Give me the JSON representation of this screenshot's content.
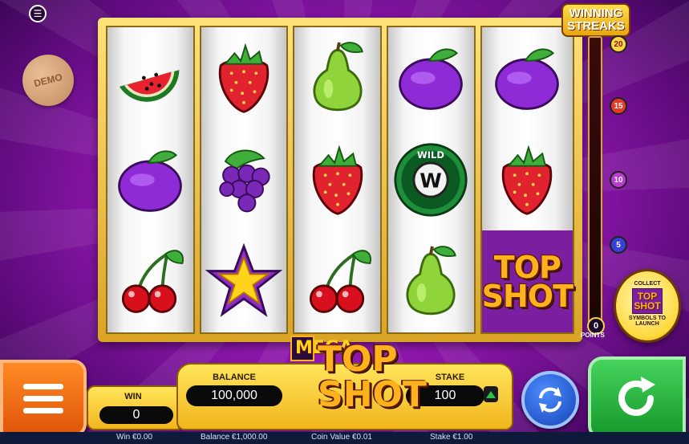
{
  "top": {
    "info_icon": "paytable-icon",
    "demo_label": "DEMO"
  },
  "reels": [
    [
      "watermelon",
      "plum",
      "cherries"
    ],
    [
      "strawberry",
      "grapes",
      "star"
    ],
    [
      "pear",
      "strawberry",
      "cherries"
    ],
    [
      "plum",
      "wild",
      "pear"
    ],
    [
      "plum",
      "strawberry",
      "top-shot"
    ]
  ],
  "symbol_text": {
    "wild": "WILD",
    "wild_letter": "W",
    "top_shot_top": "TOP",
    "top_shot_bottom": "SHOT"
  },
  "streaks": {
    "logo_line1": "WINNING",
    "logo_line2": "STREAKS",
    "ticks": [
      "20",
      "15",
      "10",
      "5"
    ],
    "points": "0",
    "points_label": "POINTS",
    "fill_fraction": 0
  },
  "collect": {
    "line1": "COLLECT",
    "mini_top": "TOP",
    "mini_shot": "SHOT",
    "line2": "SYMBOLS TO",
    "line3": "LAUNCH"
  },
  "controls": {
    "win_label": "WIN",
    "win_value": "0",
    "balance_label": "BALANCE",
    "balance_value": "100,000",
    "stake_label": "STAKE",
    "stake_value": "100"
  },
  "logo": {
    "mega": "MEGA",
    "top": "TOP",
    "shot": "SHOT"
  },
  "status": {
    "win": "Win €0.00",
    "balance": "Balance €1,000.00",
    "coin_value": "Coin Value €0.01",
    "stake": "Stake €1.00"
  },
  "colors": {
    "background": "#9a1ab8",
    "frame": "#d9a325",
    "menu": "#e0550a",
    "spin": "#14982a",
    "autoplay": "#1543b6"
  }
}
